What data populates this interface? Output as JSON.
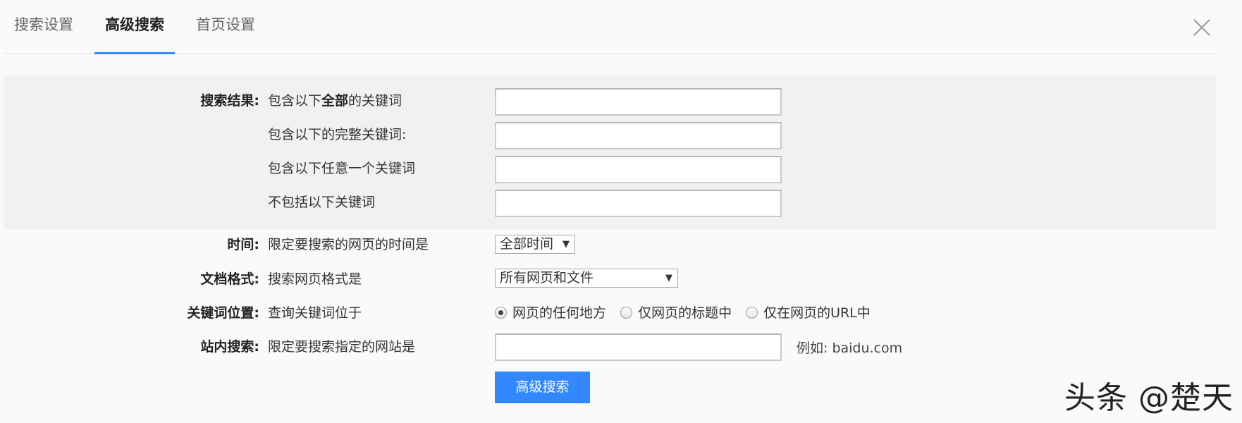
{
  "tabs": [
    {
      "label": "搜索设置"
    },
    {
      "label": "高级搜索"
    },
    {
      "label": "首页设置"
    }
  ],
  "results": {
    "head": "搜索结果:",
    "all_pre": "包含以下",
    "all_bold": "全部",
    "all_post": "的关键词",
    "exact": "包含以下的完整关键词:",
    "any": "包含以下任意一个关键词",
    "exclude": "不包括以下关键词"
  },
  "time": {
    "head": "时间:",
    "desc": "限定要搜索的网页的时间是",
    "selected": "全部时间"
  },
  "format": {
    "head": "文档格式:",
    "desc": "搜索网页格式是",
    "selected": "所有网页和文件"
  },
  "position": {
    "head": "关键词位置:",
    "desc": "查询关键词位于",
    "options": [
      "网页的任何地方",
      "仅网页的标题中",
      "仅在网页的URL中"
    ],
    "selected_index": 0
  },
  "site": {
    "head": "站内搜索:",
    "desc": "限定要搜索指定的网站是",
    "example": "例如: baidu.com"
  },
  "submit_label": "高级搜索",
  "watermark": "头条 @楚天",
  "colors": {
    "accent": "#3388ff",
    "shaded_bg": "#f1f1f1"
  }
}
